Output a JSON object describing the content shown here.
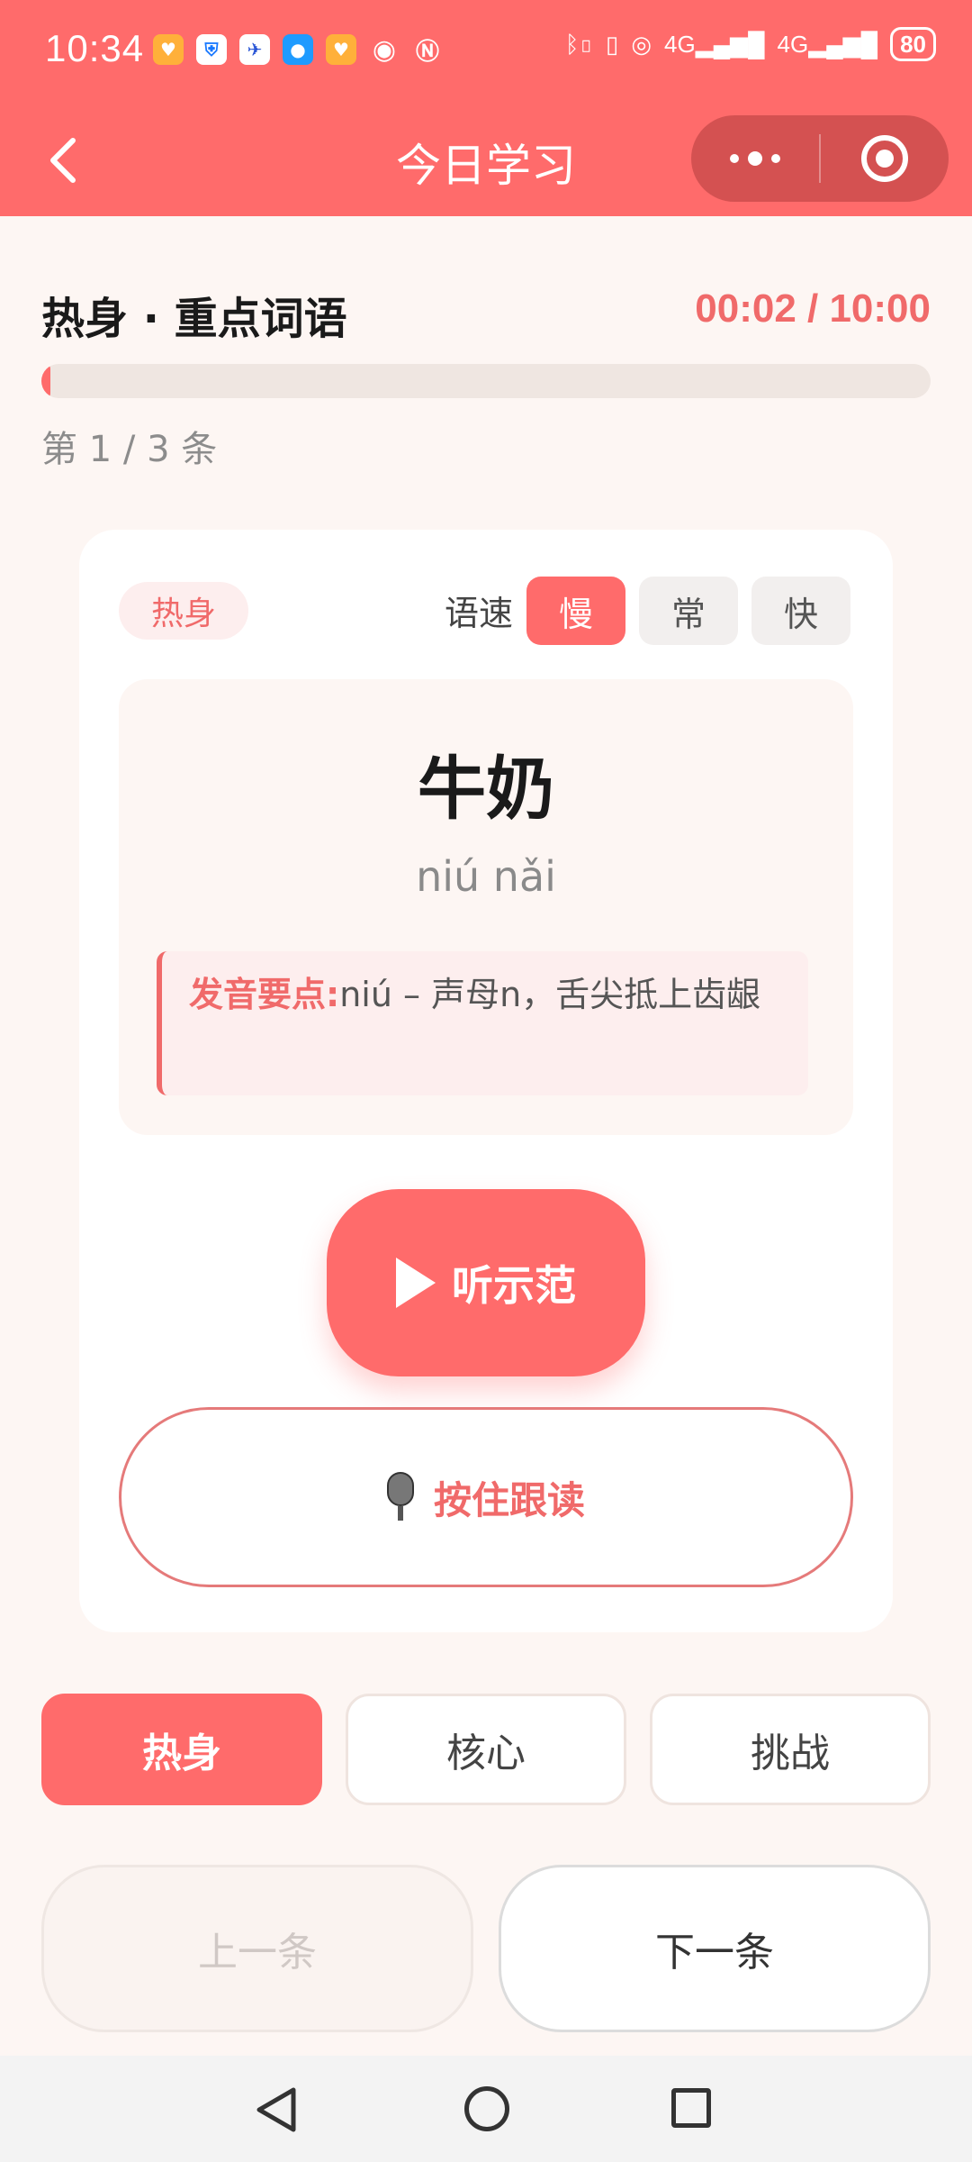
{
  "status_bar": {
    "time": "10:34",
    "network": "4G",
    "battery": "80"
  },
  "nav": {
    "title": "今日学习"
  },
  "section": {
    "title": "热身 · 重点词语",
    "timer": "00:02 / 10:00",
    "counter": "第 1 / 3 条",
    "progress": 0.003
  },
  "card": {
    "tag": "热身",
    "speed_label": "语速",
    "speeds": [
      "慢",
      "常",
      "快"
    ],
    "selected_speed": "慢",
    "word": "牛奶",
    "pinyin": "niú nǎi",
    "tip_label": "发音要点:",
    "tip_text": "niú – 声母n，舌尖抵上齿龈",
    "listen_label": "听示范",
    "record_label": "按住跟读"
  },
  "levels": {
    "items": [
      "热身",
      "核心",
      "挑战"
    ],
    "selected": "热身"
  },
  "footer": {
    "prev_label": "上一条",
    "next_label": "下一条"
  },
  "colors": {
    "accent": "#ff6b6b",
    "background": "#fdf6f3"
  }
}
